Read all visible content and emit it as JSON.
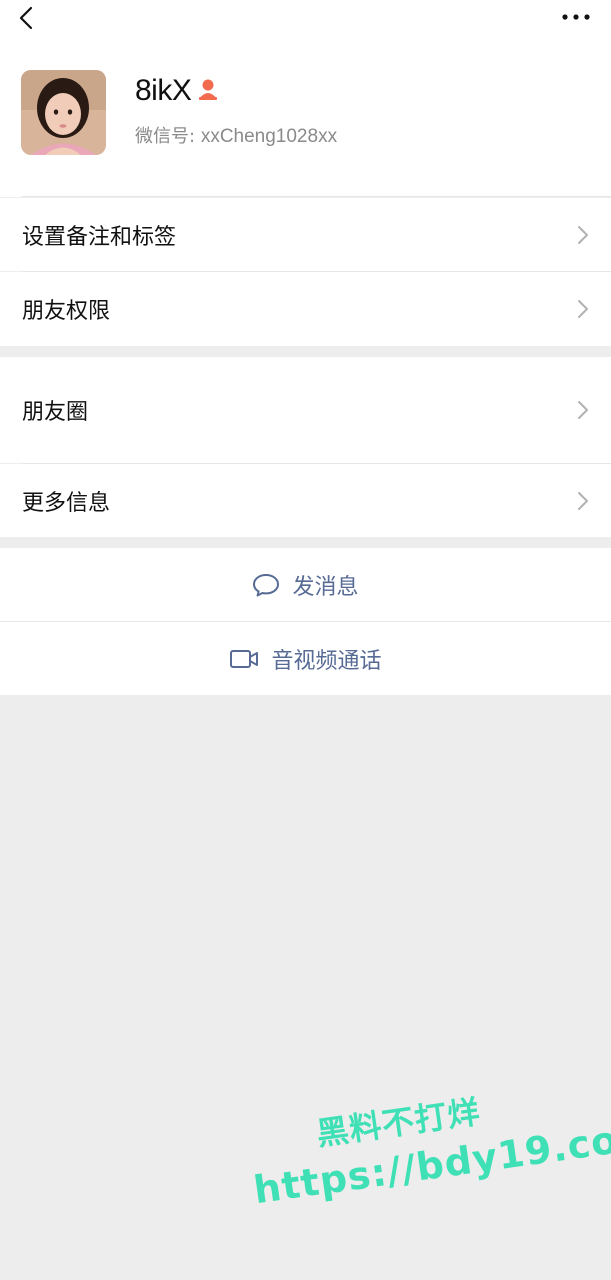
{
  "header": {
    "back_icon": "chevron-left-icon",
    "more_icon": "more-horizontal-icon"
  },
  "profile": {
    "nickname": "8ikX",
    "gender_icon": "female-person-icon",
    "wechat_id_label": "微信号:",
    "wechat_id": "xxCheng1028xx"
  },
  "menu_group1": [
    {
      "label": "设置备注和标签"
    },
    {
      "label": "朋友权限"
    }
  ],
  "menu_group2": [
    {
      "label": "朋友圈"
    },
    {
      "label": "更多信息"
    }
  ],
  "actions": {
    "message": "发消息",
    "call": "音视频通话"
  },
  "watermark": {
    "line1": "黑料不打烊",
    "line2": "https://bdy19.co"
  },
  "colors": {
    "link": "#576b95",
    "gender_icon": "#f26b4f",
    "watermark": "#3fe0b5"
  }
}
